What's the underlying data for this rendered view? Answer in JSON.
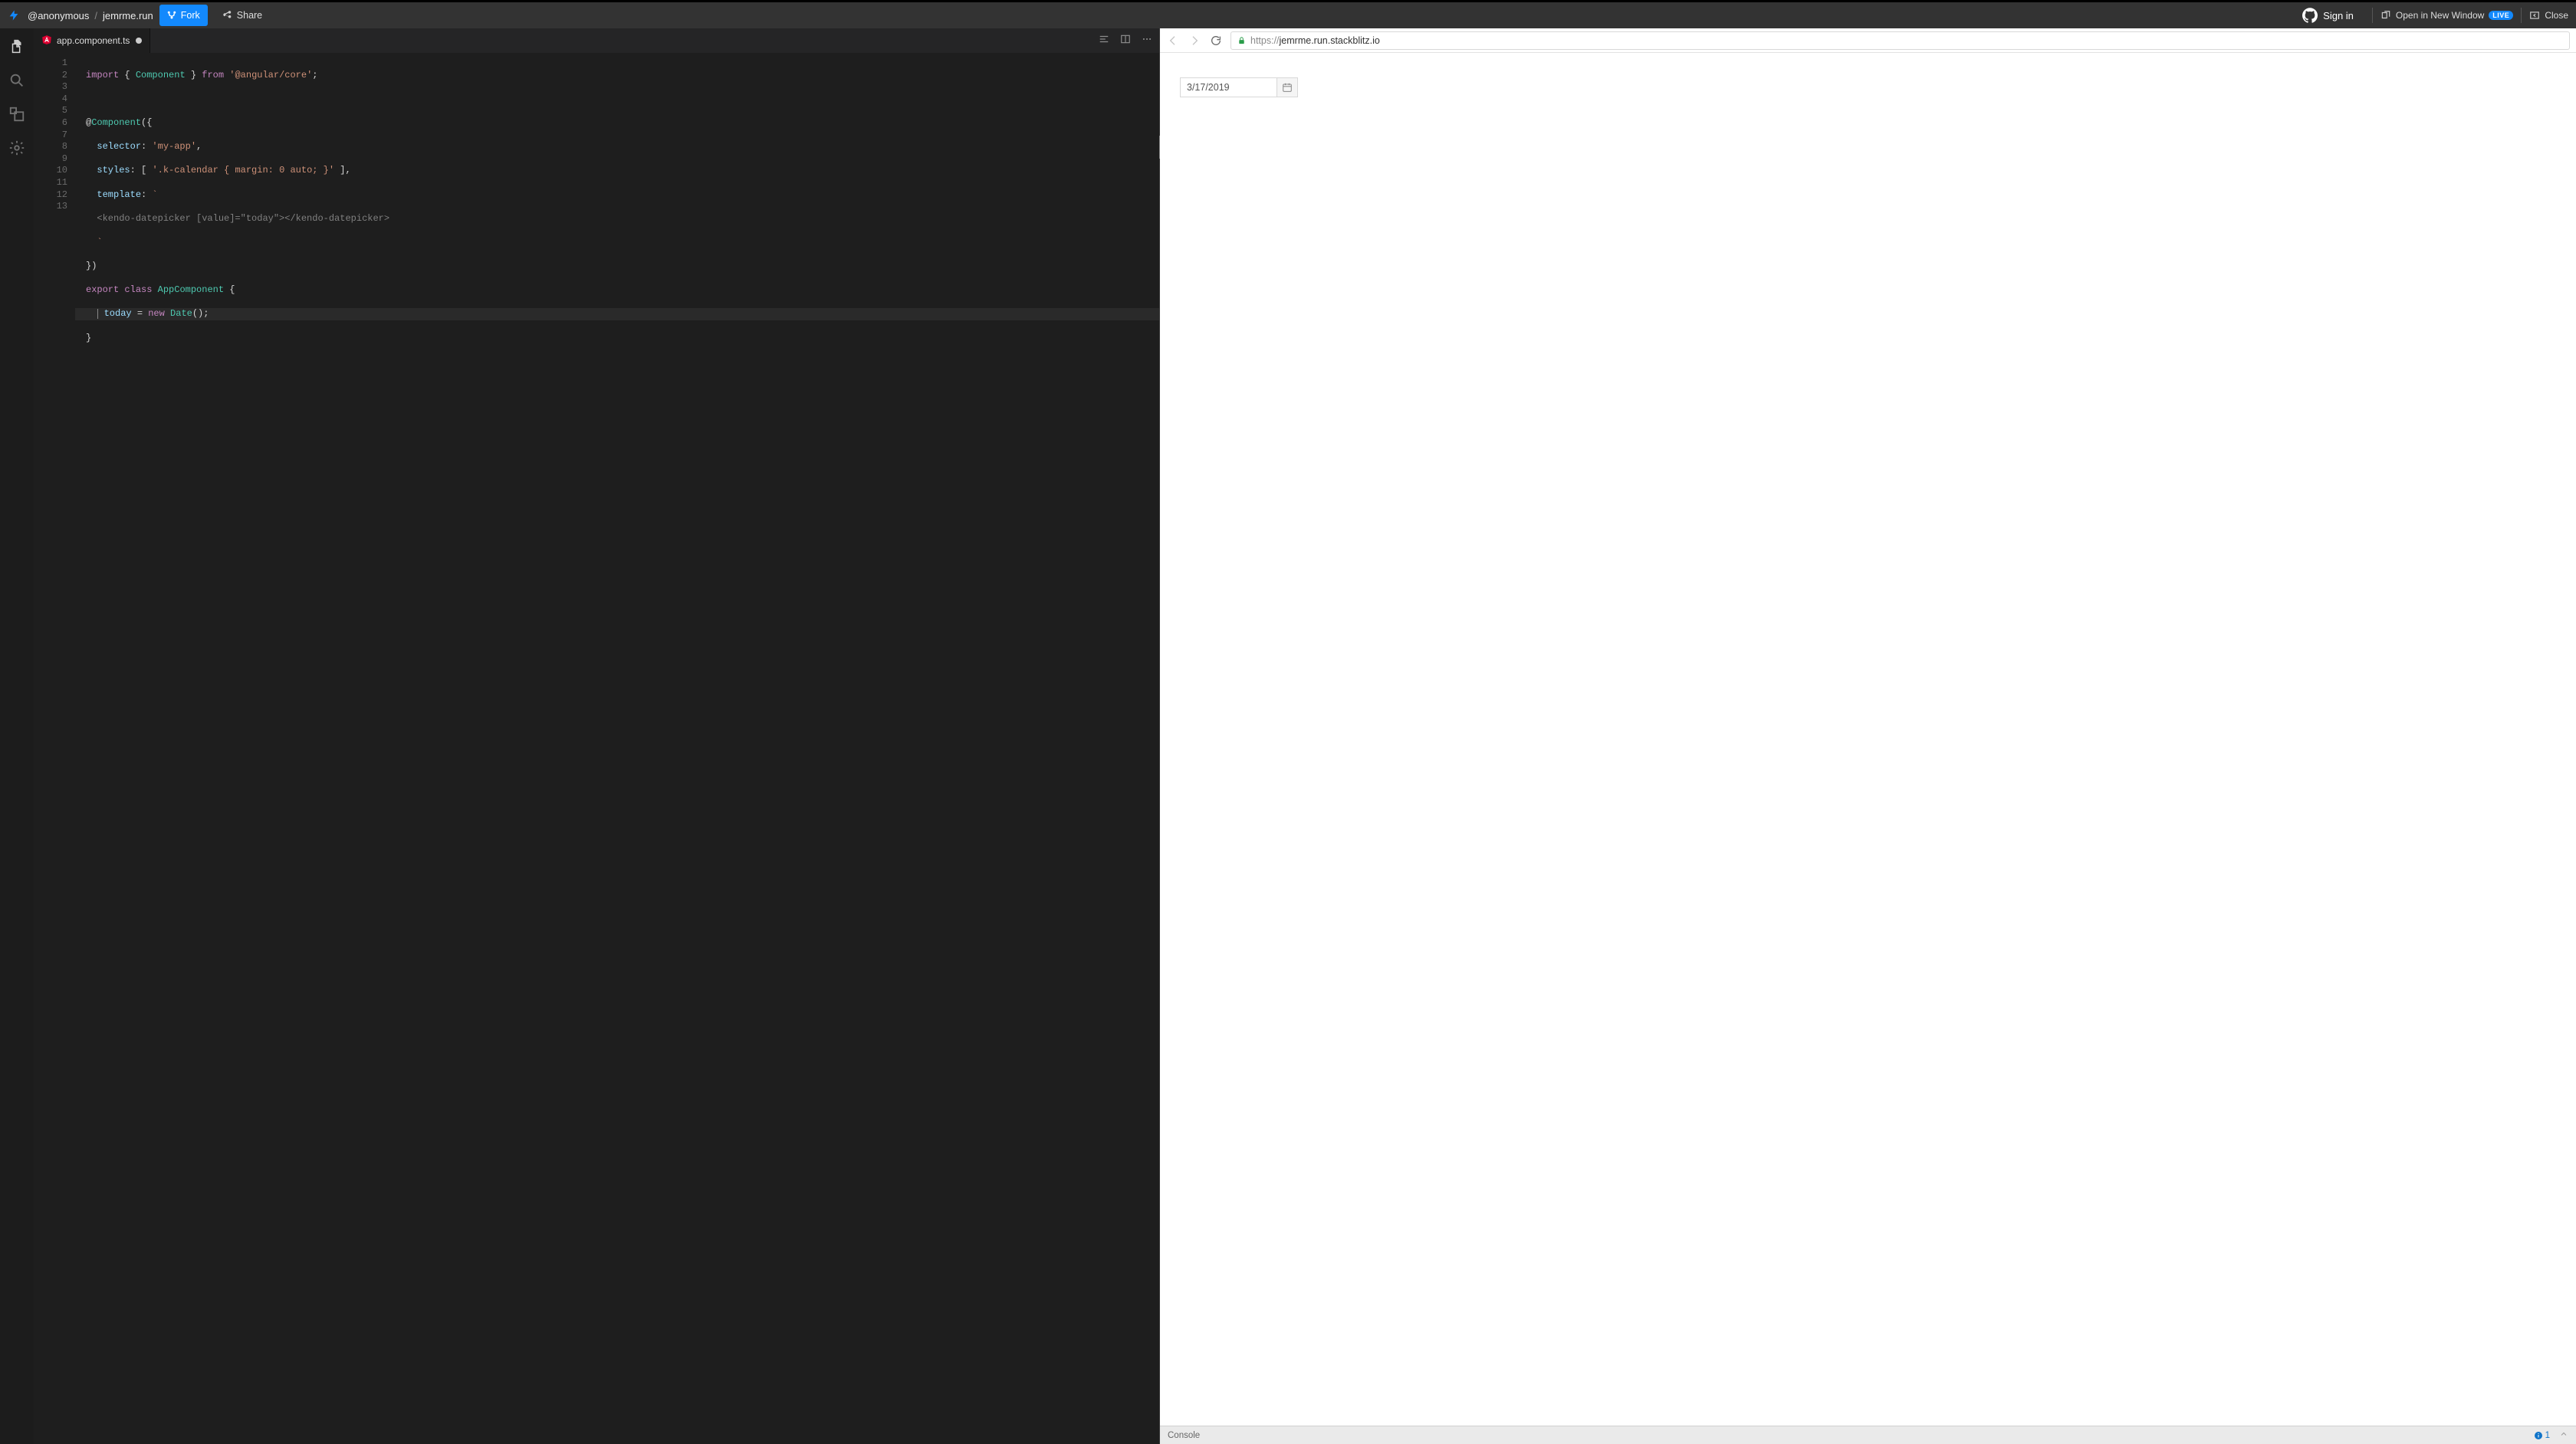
{
  "header": {
    "owner": "@anonymous",
    "project": "jemrme.run",
    "fork_label": "Fork",
    "share_label": "Share",
    "signin_label": "Sign in",
    "open_new_window_label": "Open in New Window",
    "live_badge": "LIVE",
    "close_label": "Close"
  },
  "activitybar": {
    "items": [
      "files",
      "search",
      "ports",
      "settings"
    ]
  },
  "tabs": {
    "active": {
      "filename": "app.component.ts",
      "dirty": true
    }
  },
  "editor": {
    "line_count": 13,
    "highlighted_line": 11,
    "lines_plain": [
      "import { Component } from '@angular/core';",
      "",
      "@Component({",
      "  selector: 'my-app',",
      "  styles: [ '.k-calendar { margin: 0 auto; }' ],",
      "  template: `",
      "  <kendo-datepicker [value]=\"today\"></kendo-datepicker>",
      "  `",
      "})",
      "export class AppComponent {",
      "   today = new Date();",
      "}",
      ""
    ]
  },
  "preview": {
    "url_proto": "https://",
    "url_host": "jemrme.run.stackblitz.io",
    "datepicker_value": "3/17/2019"
  },
  "console": {
    "label": "Console",
    "info_count": "1"
  }
}
